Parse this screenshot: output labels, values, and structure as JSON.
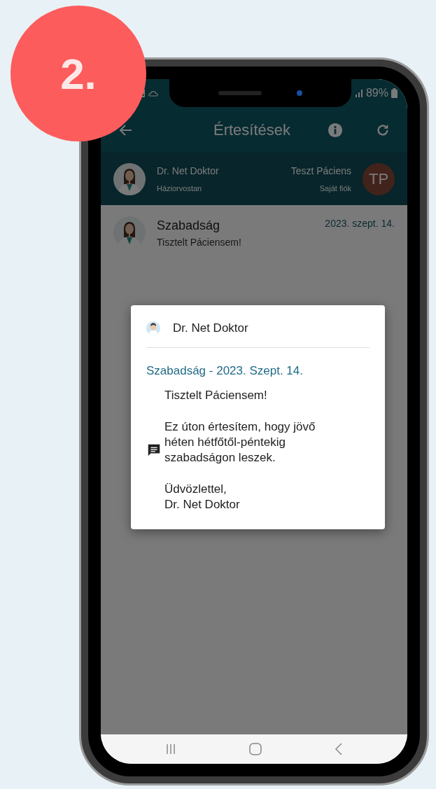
{
  "step_badge": "2.",
  "status_bar": {
    "battery": "89%"
  },
  "app_bar": {
    "title": "Értesítések"
  },
  "account": {
    "doctor_name": "Dr. Net Doktor",
    "doctor_role": "Háziorvostan",
    "patient_name": "Teszt Páciens",
    "patient_account": "Saját fiók",
    "patient_initials": "TP"
  },
  "notifications": [
    {
      "title": "Szabadság",
      "preview": "Tisztelt Páciensem!",
      "date": "2023. szept. 14."
    }
  ],
  "dialog": {
    "sender": "Dr. Net Doktor",
    "title": "Szabadság - 2023. Szept. 14.",
    "paragraphs": [
      [
        "Tisztelt Páciensem!"
      ],
      [
        "Ez úton értesítem, hogy jövő",
        "héten hétfőtől-péntekig",
        "szabadságon leszek."
      ],
      [
        "Üdvözlettel,",
        "Dr. Net Doktor"
      ]
    ]
  }
}
